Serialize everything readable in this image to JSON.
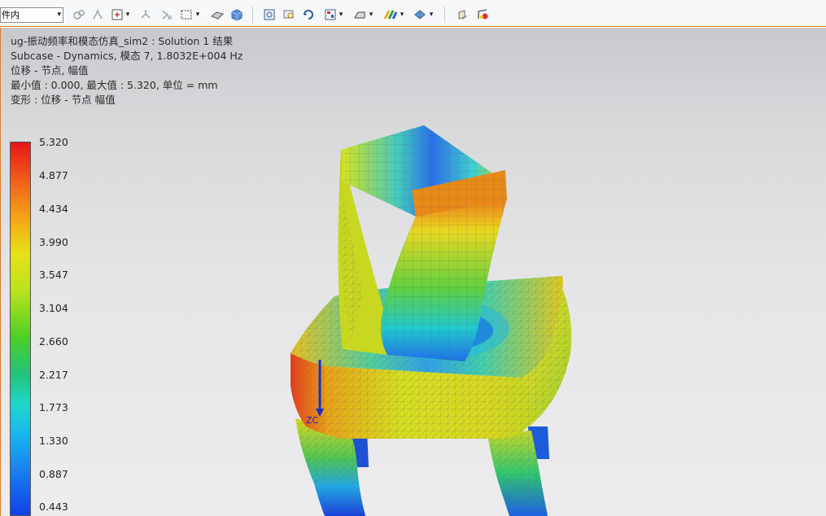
{
  "toolbar": {
    "filter_value": "件内",
    "arrow": "▾"
  },
  "icons": [
    "snap-point-icon",
    "wcs-icon",
    "snap-dropdown-icon",
    "dynamic-wcs-icon",
    "origin-icon",
    "select-box-icon",
    "shaded-edges-icon",
    "shaded-icon",
    "fit-view-icon",
    "zoom-icon",
    "rotate-icon",
    "view-layout-icon",
    "render-style-icon",
    "edge-display-icon",
    "background-icon",
    "section-icon",
    "transparency-icon"
  ],
  "info": {
    "line1": "ug-振动频率和模态仿真_sim2 : Solution 1 结果",
    "line2": "Subcase - Dynamics, 模态 7, 1.8032E+004 Hz",
    "line3": "位移 - 节点, 幅值",
    "line4": "最小值 : 0.000, 最大值 : 5.320, 单位 = mm",
    "line5": "变形 : 位移 - 节点 幅值"
  },
  "legend": {
    "values": [
      "5.320",
      "4.877",
      "4.434",
      "3.990",
      "3.547",
      "3.104",
      "2.660",
      "2.217",
      "1.773",
      "1.330",
      "0.887",
      "0.443"
    ]
  },
  "triad": {
    "z_label": "ZC"
  }
}
